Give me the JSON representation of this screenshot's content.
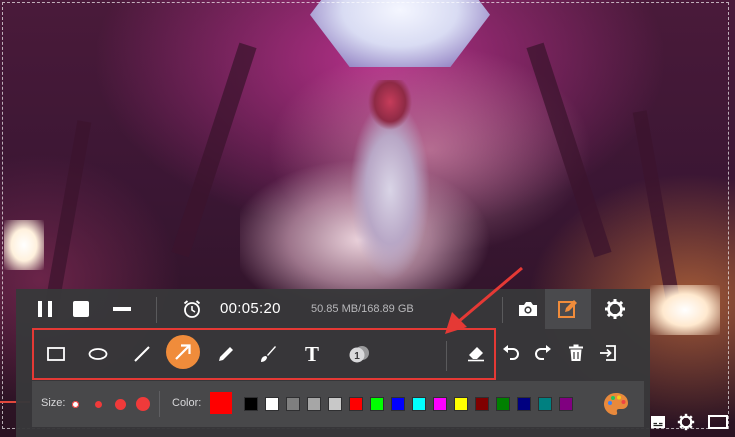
{
  "recorder": {
    "timer": "00:05:20",
    "file_size": "50.85 MB/168.89 GB"
  },
  "tools": [
    {
      "name": "rectangle",
      "icon": "rectangle-icon"
    },
    {
      "name": "ellipse",
      "icon": "ellipse-icon"
    },
    {
      "name": "line",
      "icon": "line-icon"
    },
    {
      "name": "arrow",
      "icon": "arrow-icon",
      "active": true
    },
    {
      "name": "pen",
      "icon": "pen-icon"
    },
    {
      "name": "brush",
      "icon": "brush-icon"
    },
    {
      "name": "text",
      "icon": "text-icon",
      "glyph": "T"
    },
    {
      "name": "callout",
      "icon": "numbered-callout-icon",
      "glyph": "1"
    }
  ],
  "options": {
    "size_label": "Size:",
    "sizes_selected": 1,
    "color_label": "Color:",
    "current_color": "#ff0000",
    "swatches": [
      "#000000",
      "#ffffff",
      "#7f7f7f",
      "#a6a6a6",
      "#c8c8c8",
      "#ff0000",
      "#00ff00",
      "#0000ff",
      "#00ffff",
      "#ff00ff",
      "#ffff00",
      "#800000",
      "#008000",
      "#000080",
      "#008080",
      "#800080"
    ]
  },
  "colors": {
    "accent": "#f08c3b",
    "highlight_border": "#e53935"
  }
}
